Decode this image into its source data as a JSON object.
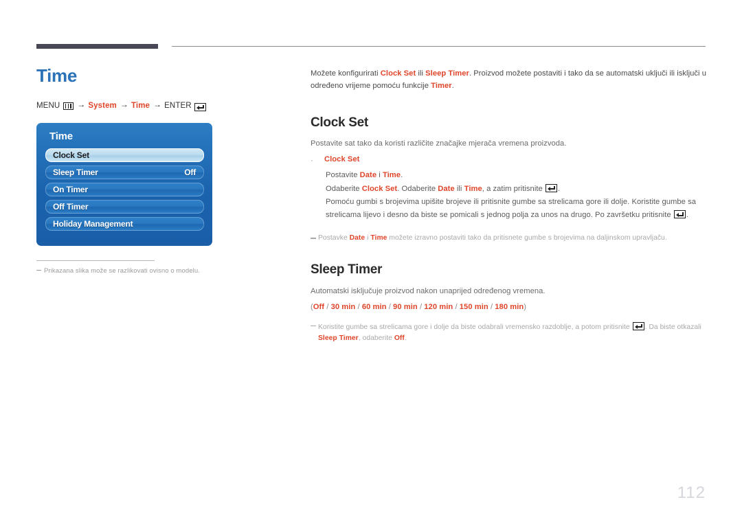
{
  "header": {
    "rule_color": "#474755"
  },
  "page": {
    "title": "Time",
    "number": "112",
    "title_color": "#2b72b8",
    "accent_color": "#e0452a"
  },
  "breadcrumb": {
    "menu_label": "MENU",
    "menu_icon": "menu-grid-icon",
    "arrow": "→",
    "step_system": "System",
    "step_time": "Time",
    "enter_label": "ENTER",
    "enter_icon": "enter-key-icon"
  },
  "osd": {
    "title": "Time",
    "rows": [
      {
        "label": "Clock Set",
        "value": "",
        "selected": true
      },
      {
        "label": "Sleep Timer",
        "value": "Off",
        "selected": false
      },
      {
        "label": "On Timer",
        "value": "",
        "selected": false
      },
      {
        "label": "Off Timer",
        "value": "",
        "selected": false
      },
      {
        "label": "Holiday Management",
        "value": "",
        "selected": false
      }
    ]
  },
  "left_note": {
    "dash": "–",
    "text": "Prikazana slika može se razlikovati ovisno o modelu."
  },
  "intro": {
    "p1": "Možete konfigurirati ",
    "b1": "Clock Set",
    "p2": " ili ",
    "b2": "Sleep Timer",
    "p3": ". Proizvod možete postaviti i tako da se automatski uključi ili isključi u određeno vrijeme pomoću funkcije ",
    "b3": "Timer",
    "p4": "."
  },
  "clock_set": {
    "heading": "Clock Set",
    "description": "Postavite sat tako da koristi različite značajke mjerača vremena proizvoda.",
    "bullet_label": "Clock Set",
    "line1_a": "Postavite ",
    "line1_b": "Date",
    "line1_c": " i ",
    "line1_d": "Time",
    "line1_e": ".",
    "line2_a": "Odaberite ",
    "line2_b": "Clock Set",
    "line2_c": ". Odaberite ",
    "line2_d": "Date",
    "line2_e": " ili ",
    "line2_f": "Time",
    "line2_g": ", a zatim pritisnite ",
    "line2_h": ".",
    "line3_a": "Pomoću gumbi s brojevima upišite brojeve ili pritisnite gumbe sa strelicama gore ili dolje. Koristite gumbe sa strelicama lijevo i desno da biste se pomicali s jednog polja za unos na drugo. Po završetku pritisnite ",
    "line3_b": ".",
    "note_a": "Postavke ",
    "note_b": "Date",
    "note_c": " i ",
    "note_d": "Time",
    "note_e": " možete izravno postaviti tako da pritisnete gumbe s brojevima na daljinskom upravljaču."
  },
  "sleep_timer": {
    "heading": "Sleep Timer",
    "description": "Automatski isključuje proizvod nakon unaprijed određenog vremena.",
    "options_open": "(",
    "options": [
      "Off",
      "30 min",
      "60 min",
      "90 min",
      "120 min",
      "150 min",
      "180 min"
    ],
    "options_close": ")",
    "note_a": "Koristite gumbe sa strelicama gore i dolje da biste odabrali vremensko razdoblje, a potom pritisnite ",
    "note_b": ". Da biste otkazali ",
    "note_c": "Sleep Timer",
    "note_d": ", odaberite ",
    "note_e": "Off",
    "note_f": "."
  }
}
